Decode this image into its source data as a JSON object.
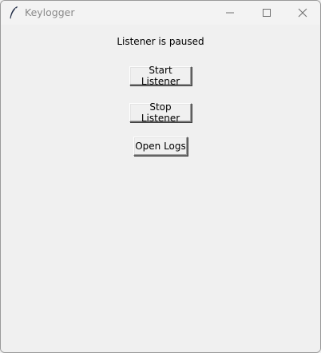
{
  "window": {
    "title": "Keylogger",
    "icon": "feather-icon",
    "controls": {
      "minimize": "minimize-icon",
      "maximize": "maximize-icon",
      "close": "close-icon"
    }
  },
  "main": {
    "status_text": "Listener is paused",
    "start_label": "Start Listener",
    "stop_label": "Stop Listener",
    "logs_label": "Open Logs"
  },
  "colors": {
    "background": "#f0f0f0",
    "title_text": "#8a8a8a",
    "button_text": "#000000"
  }
}
